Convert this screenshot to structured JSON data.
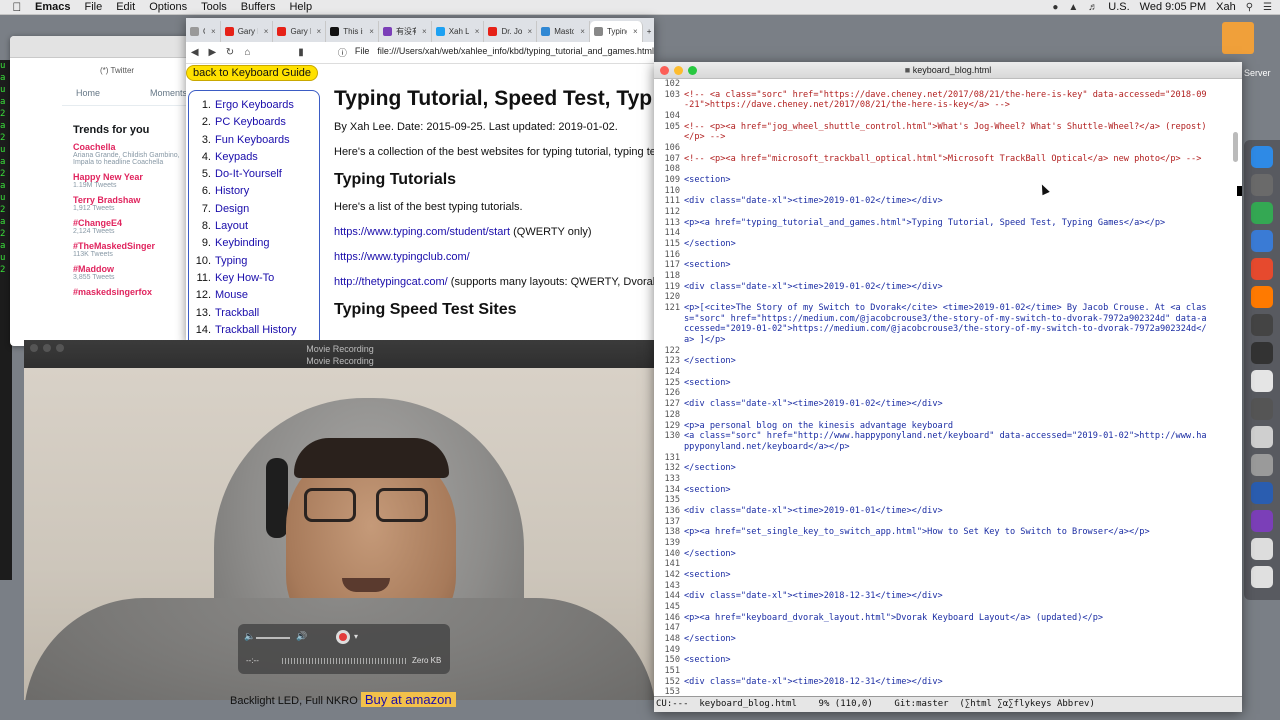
{
  "menubar": {
    "apple": "",
    "app_name": "Emacs",
    "items": [
      "File",
      "Edit",
      "Options",
      "Tools",
      "Buffers",
      "Help"
    ],
    "input_source": "U.S.",
    "clock": "Wed 9:05 PM",
    "user": "Xah"
  },
  "desktop": {
    "folder_label": "Server"
  },
  "twitter": {
    "window_title": "(*) Twitter",
    "nav_home": "Home",
    "nav_moments": "Moments",
    "trends_title": "Trends for you",
    "trends": [
      {
        "name": "Coachella",
        "desc": "Ariana Grande, Childish Gambino, Impala to headline Coachella"
      },
      {
        "name": "Happy New Year",
        "desc": "1.19M Tweets"
      },
      {
        "name": "Terry Bradshaw",
        "desc": "1,912 Tweets"
      },
      {
        "name": "#ChangeE4",
        "desc": "2,124 Tweets"
      },
      {
        "name": "#TheMaskedSinger",
        "desc": "113K Tweets"
      },
      {
        "name": "#Maddow",
        "desc": "3,855 Tweets"
      },
      {
        "name": "#maskedsingerfox",
        "desc": ""
      }
    ]
  },
  "terminal_lines": [
    "u",
    "a",
    "u",
    "a",
    "2",
    "a",
    "2",
    "u",
    "a",
    "2",
    "a",
    "u",
    "2",
    "a",
    "2",
    "a",
    "u",
    "2"
  ],
  "browser": {
    "tabs": [
      {
        "label": "Ch",
        "color": "#999999"
      },
      {
        "label": "Gary B.B. Colema",
        "color": "#e62117"
      },
      {
        "label": "Gary B.B. Colema",
        "color": "#e62117"
      },
      {
        "label": "This is how Goog",
        "color": "#111111"
      },
      {
        "label": "有没有现成的, 可",
        "color": "#7b3fb8"
      },
      {
        "label": "Xah Lee on Twitte",
        "color": "#1da1f2"
      },
      {
        "label": "Dr. Jordan B Pete",
        "color": "#e62117"
      },
      {
        "label": "Mastodon",
        "color": "#3088d4"
      },
      {
        "label": "Typing Tutorial, Sp",
        "color": "#888888",
        "active": true
      }
    ],
    "new_tab": "+",
    "url_scheme": "File",
    "url": "file:///Users/xah/web/xahlee_info/kbd/typing_tutorial_and_games.html",
    "back_button": "back to Keyboard Guide",
    "nav_items": [
      {
        "num": "1.",
        "label": "Ergo Keyboards"
      },
      {
        "num": "2.",
        "label": "PC Keyboards"
      },
      {
        "num": "3.",
        "label": "Fun Keyboards"
      },
      {
        "num": "4.",
        "label": "Keypads"
      },
      {
        "num": "5.",
        "label": "Do-It-Yourself"
      },
      {
        "num": "6.",
        "label": "History"
      },
      {
        "num": "7.",
        "label": "Design"
      },
      {
        "num": "8.",
        "label": "Layout"
      },
      {
        "num": "9.",
        "label": "Keybinding"
      },
      {
        "num": "10.",
        "label": "Typing"
      },
      {
        "num": "11.",
        "label": "Key How-To"
      },
      {
        "num": "12.",
        "label": "Mouse"
      },
      {
        "num": "13.",
        "label": "Trackball"
      },
      {
        "num": "14.",
        "label": "Trackball History"
      }
    ],
    "article": {
      "title": "Typing Tutorial, Speed Test, Typ",
      "byline": "By Xah Lee. Date: 2015-09-25. Last updated: 2019-01-02.",
      "intro": "Here's a collection of the best websites for typing tutorial, typing test",
      "h2_tutorials": "Typing Tutorials",
      "list_intro": "Here's a list of the best typing tutorials.",
      "link1": "https://www.typing.com/student/start",
      "link1_note": " (QWERTY only)",
      "link2": "https://www.typingclub.com/",
      "link3": "http://thetypingcat.com/",
      "link3_note": " (supports many layouts: QWERTY, Dvorak,",
      "h2_speed": "Typing Speed Test Sites"
    }
  },
  "movie": {
    "title": "Movie Recording",
    "subtitle": "Movie Recording",
    "time": "--:--",
    "size": "Zero KB",
    "under_text": "Backlight LED, Full NKRO",
    "buy_label": "Buy at amazon"
  },
  "emacs": {
    "title": "keyboard_blog.html",
    "modeline": "CU:---  keyboard_blog.html    9% (110,0)    Git:master  (∑html ∑α∑flykeys Abbrev)",
    "lines": [
      {
        "n": "102",
        "t": ""
      },
      {
        "n": "103",
        "t": "<!-- <a class=\"sorc\" href=\"https://dave.cheney.net/2017/08/21/the-here-is-key\" data-accessed=\"2018-09",
        "k": "cm"
      },
      {
        "n": "",
        "t": "-21\">https://dave.cheney.net/2017/08/21/the-here-is-key</a> -->",
        "k": "cm"
      },
      {
        "n": "104",
        "t": ""
      },
      {
        "n": "105",
        "t": "<!-- <p><a href=\"jog_wheel_shuttle_control.html\">What's Jog-Wheel? What's Shuttle-Wheel?</a> (repost)",
        "k": "cm"
      },
      {
        "n": "",
        "t": "</p> -->",
        "k": "cm"
      },
      {
        "n": "106",
        "t": ""
      },
      {
        "n": "107",
        "t": "<!-- <p><a href=\"microsoft_trackball_optical.html\">Microsoft TrackBall Optical</a> new photo</p> -->",
        "k": "cm"
      },
      {
        "n": "108",
        "t": ""
      },
      {
        "n": "109",
        "t": "<section>",
        "k": "tg"
      },
      {
        "n": "110",
        "t": "",
        "cursor": true
      },
      {
        "n": "111",
        "t": "<div class=\"date-xl\"><time>2019-01-02</time></div>",
        "k": "tg"
      },
      {
        "n": "112",
        "t": ""
      },
      {
        "n": "113",
        "t": "<p><a href=\"typing_tutorial_and_games.html\">Typing Tutorial, Speed Test, Typing Games</a></p>",
        "k": "tg"
      },
      {
        "n": "114",
        "t": ""
      },
      {
        "n": "115",
        "t": "</section>",
        "k": "tg"
      },
      {
        "n": "116",
        "t": ""
      },
      {
        "n": "117",
        "t": "<section>",
        "k": "tg"
      },
      {
        "n": "118",
        "t": ""
      },
      {
        "n": "119",
        "t": "<div class=\"date-xl\"><time>2019-01-02</time></div>",
        "k": "tg"
      },
      {
        "n": "120",
        "t": ""
      },
      {
        "n": "121",
        "t": "<p>[<cite>The Story of my Switch to Dvorak</cite> <time>2019-01-02</time> By Jacob Crouse. At <a clas",
        "k": "tg"
      },
      {
        "n": "",
        "t": "s=\"sorc\" href=\"https://medium.com/@jacobcrouse3/the-story-of-my-switch-to-dvorak-7972a902324d\" data-a",
        "k": "tg"
      },
      {
        "n": "",
        "t": "ccessed=\"2019-01-02\">https://medium.com/@jacobcrouse3/the-story-of-my-switch-to-dvorak-7972a902324d</",
        "k": "tg"
      },
      {
        "n": "",
        "t": "a> ]</p>",
        "k": "tg"
      },
      {
        "n": "122",
        "t": ""
      },
      {
        "n": "123",
        "t": "</section>",
        "k": "tg"
      },
      {
        "n": "124",
        "t": ""
      },
      {
        "n": "125",
        "t": "<section>",
        "k": "tg"
      },
      {
        "n": "126",
        "t": ""
      },
      {
        "n": "127",
        "t": "<div class=\"date-xl\"><time>2019-01-02</time></div>",
        "k": "tg"
      },
      {
        "n": "128",
        "t": ""
      },
      {
        "n": "129",
        "t": "<p>a personal blog on the kinesis advantage keyboard",
        "k": "tg"
      },
      {
        "n": "130",
        "t": "<a class=\"sorc\" href=\"http://www.happyponyland.net/keyboard\" data-accessed=\"2019-01-02\">http://www.ha",
        "k": "tg"
      },
      {
        "n": "",
        "t": "ppyponyland.net/keyboard</a></p>",
        "k": "tg"
      },
      {
        "n": "131",
        "t": ""
      },
      {
        "n": "132",
        "t": "</section>",
        "k": "tg"
      },
      {
        "n": "133",
        "t": ""
      },
      {
        "n": "134",
        "t": "<section>",
        "k": "tg"
      },
      {
        "n": "135",
        "t": ""
      },
      {
        "n": "136",
        "t": "<div class=\"date-xl\"><time>2019-01-01</time></div>",
        "k": "tg"
      },
      {
        "n": "137",
        "t": ""
      },
      {
        "n": "138",
        "t": "<p><a href=\"set_single_key_to_switch_app.html\">How to Set Key to Switch to Browser</a></p>",
        "k": "tg"
      },
      {
        "n": "139",
        "t": ""
      },
      {
        "n": "140",
        "t": "</section>",
        "k": "tg"
      },
      {
        "n": "141",
        "t": ""
      },
      {
        "n": "142",
        "t": "<section>",
        "k": "tg"
      },
      {
        "n": "143",
        "t": ""
      },
      {
        "n": "144",
        "t": "<div class=\"date-xl\"><time>2018-12-31</time></div>",
        "k": "tg"
      },
      {
        "n": "145",
        "t": ""
      },
      {
        "n": "146",
        "t": "<p><a href=\"keyboard_dvorak_layout.html\">Dvorak Keyboard Layout</a> (updated)</p>",
        "k": "tg"
      },
      {
        "n": "147",
        "t": ""
      },
      {
        "n": "148",
        "t": "</section>",
        "k": "tg"
      },
      {
        "n": "149",
        "t": ""
      },
      {
        "n": "150",
        "t": "<section>",
        "k": "tg"
      },
      {
        "n": "151",
        "t": ""
      },
      {
        "n": "152",
        "t": "<div class=\"date-xl\"><time>2018-12-31</time></div>",
        "k": "tg"
      },
      {
        "n": "153",
        "t": ""
      }
    ]
  },
  "dock_colors": [
    "#2e8ae6",
    "#6a6a6a",
    "#34a853",
    "#3a7bd5",
    "#e64a2e",
    "#ff7a00",
    "#444444",
    "#333333",
    "#e5e5e5",
    "#555555",
    "#cfcfcf",
    "#9a9a9a",
    "#2a5db0",
    "#7b3fb8",
    "#dddddd",
    "#e0e0e0"
  ]
}
